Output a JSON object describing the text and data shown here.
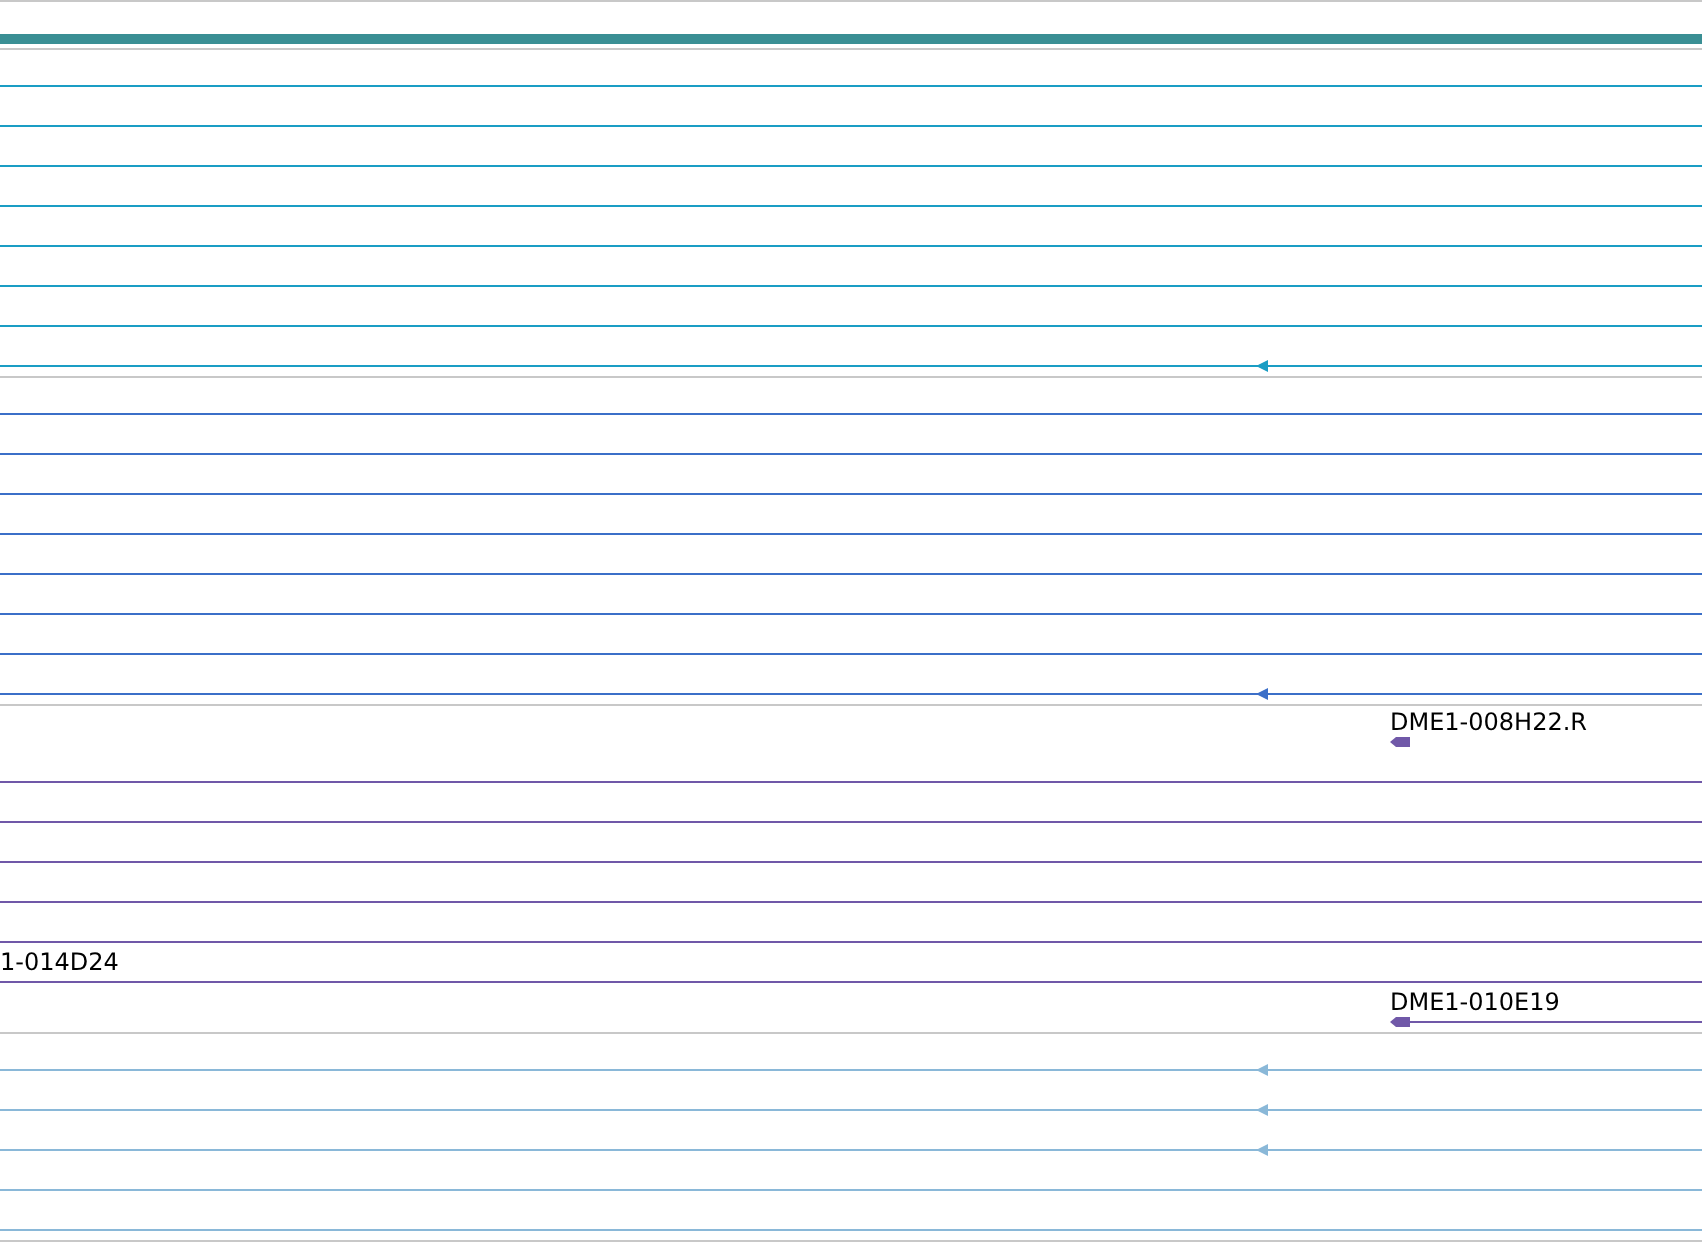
{
  "tracks": [
    {
      "color": "#1a9dc4",
      "rows": [
        {
          "kind": "line",
          "arrow": false
        },
        {
          "kind": "line",
          "arrow": false
        },
        {
          "kind": "line",
          "arrow": false
        },
        {
          "kind": "line",
          "arrow": false
        },
        {
          "kind": "line",
          "arrow": false
        },
        {
          "kind": "line",
          "arrow": false
        },
        {
          "kind": "line",
          "arrow": false
        },
        {
          "kind": "line",
          "arrow": true
        }
      ]
    },
    {
      "color": "#3b6fc8",
      "rows": [
        {
          "kind": "line",
          "arrow": false
        },
        {
          "kind": "line",
          "arrow": false
        },
        {
          "kind": "line",
          "arrow": false
        },
        {
          "kind": "line",
          "arrow": false
        },
        {
          "kind": "line",
          "arrow": false
        },
        {
          "kind": "line",
          "arrow": false
        },
        {
          "kind": "line",
          "arrow": false
        },
        {
          "kind": "line",
          "arrow": true
        }
      ]
    },
    {
      "color": "#7058a8",
      "rows": [
        {
          "kind": "stub",
          "label": "DME1-008H22.R"
        },
        {
          "kind": "line",
          "arrow": false
        },
        {
          "kind": "line",
          "arrow": false
        },
        {
          "kind": "line",
          "arrow": false
        },
        {
          "kind": "line",
          "arrow": false
        },
        {
          "kind": "line",
          "arrow": false
        },
        {
          "kind": "line",
          "arrow": false,
          "label": "1-014D24"
        },
        {
          "kind": "tail",
          "label": "DME1-010E19"
        }
      ]
    },
    {
      "color": "#8ab8d8",
      "rows": [
        {
          "kind": "line",
          "arrow": true
        },
        {
          "kind": "line",
          "arrow": true
        },
        {
          "kind": "line",
          "arrow": true
        },
        {
          "kind": "line",
          "arrow": false
        },
        {
          "kind": "line",
          "arrow": false
        }
      ]
    }
  ]
}
